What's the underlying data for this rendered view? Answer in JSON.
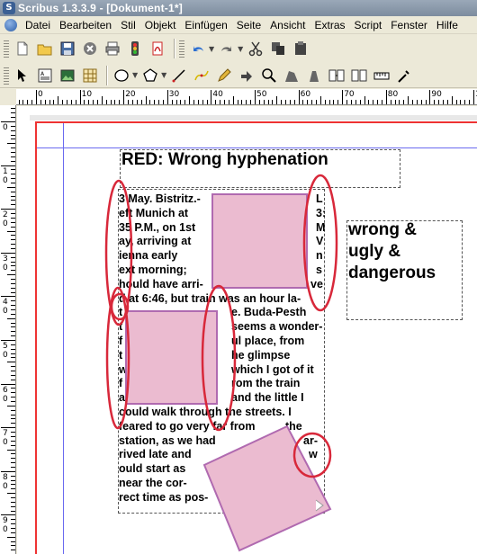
{
  "window": {
    "title": "Scribus 1.3.3.9 - [Dokument-1*]"
  },
  "menu": [
    "Datei",
    "Bearbeiten",
    "Stil",
    "Objekt",
    "Einfügen",
    "Seite",
    "Ansicht",
    "Extras",
    "Script",
    "Fenster",
    "Hilfe"
  ],
  "ruler_h_labels": [
    "0",
    "10",
    "20",
    "30",
    "40",
    "50",
    "60",
    "70",
    "80",
    "90",
    "100"
  ],
  "ruler_v_labels": [
    "0",
    "1\n0",
    "2\n0",
    "3\n0",
    "4\n0",
    "5\n0",
    "6\n0",
    "7\n0",
    "8\n0",
    "9\n0"
  ],
  "document": {
    "headline": "RED: Wrong hyphenation",
    "side_lines": [
      "wrong &",
      "ugly &",
      "dangerous"
    ],
    "text_lines": [
      {
        "left": "3 May. Bistritz.-",
        "right": "L"
      },
      {
        "left": "eft Munich at",
        "right": "3:"
      },
      {
        "left": "35 P.M., on 1st",
        "right": "M"
      },
      {
        "left": "ay, arriving at",
        "right": "V"
      },
      {
        "left": "ienna early",
        "right": "n"
      },
      {
        "left": "ext morning;",
        "right": "s"
      },
      {
        "left": "hould have arri-",
        "right": "ve"
      },
      {
        "left": "d at 6:46, but train was an hour la-",
        "right": ""
      },
      {
        "left": "t",
        "right": "e. Buda-Pesth"
      },
      {
        "left": "t",
        "right": "seems a wonder-"
      },
      {
        "left": "f",
        "right": "ul place, from"
      },
      {
        "left": "t",
        "right": "he glimpse"
      },
      {
        "left": "w",
        "right": "which I got of it"
      },
      {
        "left": "f",
        "right": "rom the train"
      },
      {
        "left": "a",
        "right": "and the little I"
      },
      {
        "left": "could walk through the streets. I",
        "right": ""
      },
      {
        "left": "feared to go very far from",
        "right": "the"
      },
      {
        "left": "station, as we had",
        "right": "ar-"
      },
      {
        "left": "rived late and",
        "right": "w"
      },
      {
        "left": "ould start as",
        "right": ""
      },
      {
        "left": "near the cor-",
        "right": ""
      },
      {
        "left": "rect time as pos-",
        "right": ""
      }
    ]
  },
  "colors": {
    "page_border": "#e33333",
    "margin_guide": "#6a6af0",
    "shape_fill": "#ebbbd0",
    "shape_stroke": "#b06ab0",
    "annotation": "#d8283a"
  }
}
